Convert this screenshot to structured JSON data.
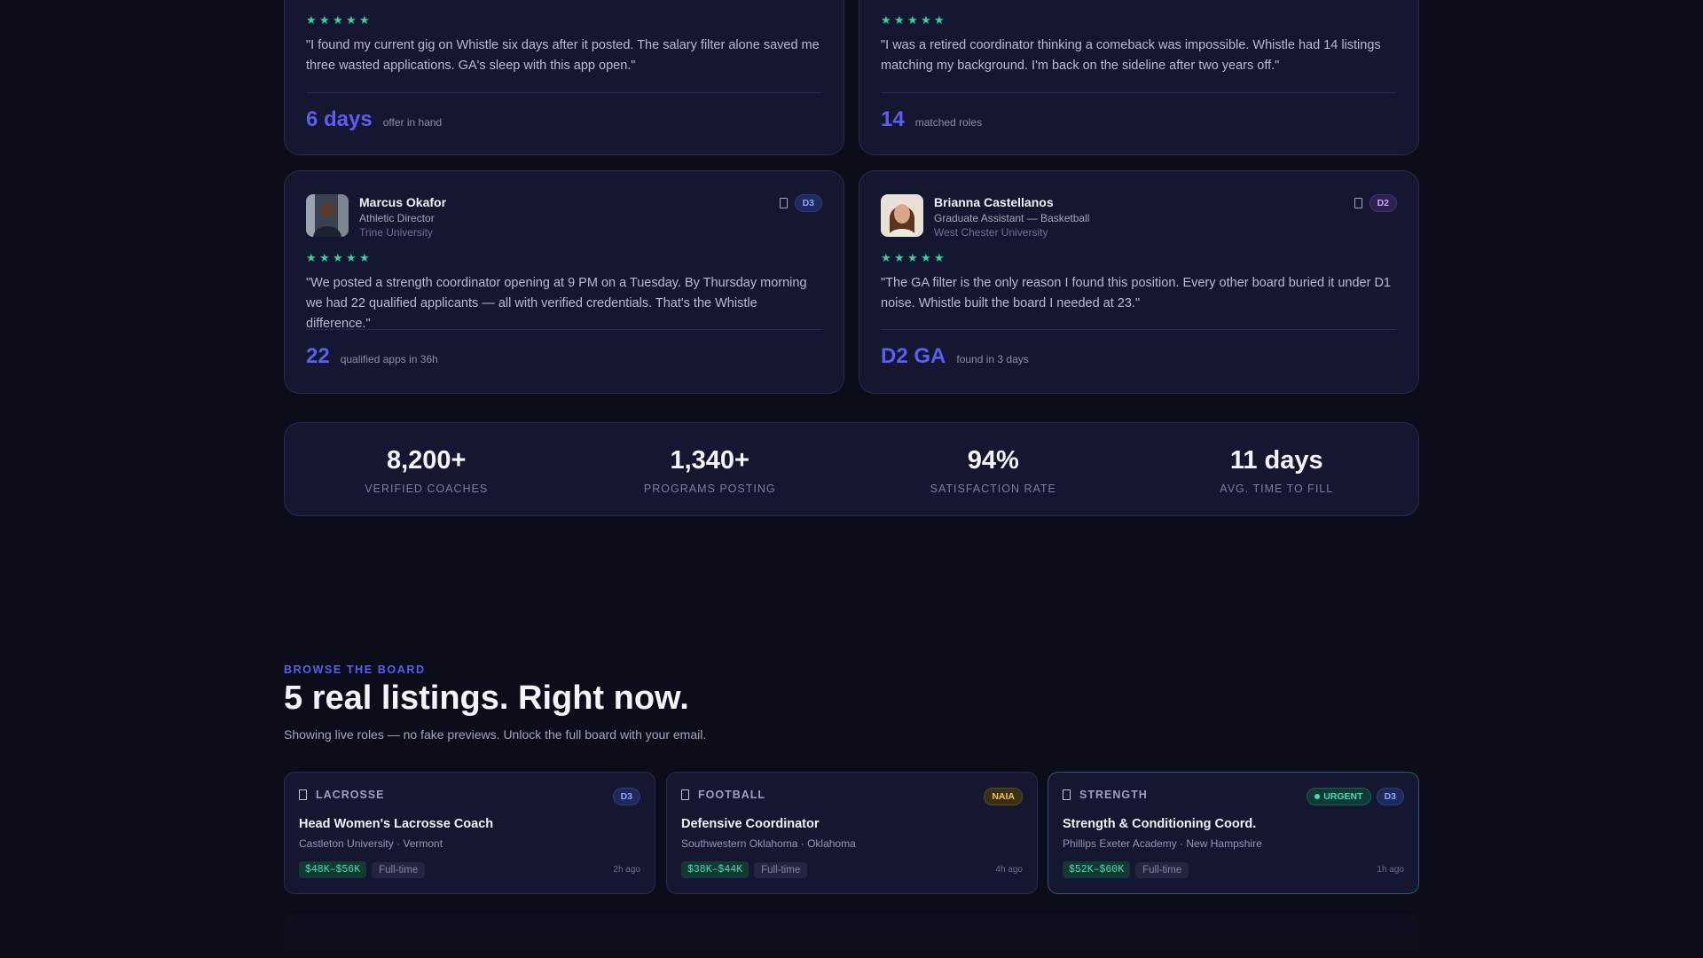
{
  "testimonials_top": [
    {
      "quote": "\"I found my current gig on Whistle six days after it posted. The salary filter alone saved me three wasted applications. GA's sleep with this app open.\"",
      "metric_value": "6 days",
      "metric_label": "offer in hand"
    },
    {
      "quote": "\"I was a retired coordinator thinking a comeback was impossible. Whistle had 14 listings matching my background. I'm back on the sideline after two years off.\"",
      "metric_value": "14",
      "metric_label": "matched roles"
    }
  ],
  "testimonials": [
    {
      "name": "Marcus Okafor",
      "role": "Athletic Director",
      "org": "Trine University",
      "division": "D3",
      "quote": "\"We posted a strength coordinator opening at 9 PM on a Tuesday. By Thursday morning we had 22 qualified applicants — all with verified credentials. That's the Whistle difference.\"",
      "metric_value": "22",
      "metric_label": "qualified apps in 36h"
    },
    {
      "name": "Brianna Castellanos",
      "role": "Graduate Assistant — Basketball",
      "org": "West Chester University",
      "division": "D2",
      "quote": "\"The GA filter is the only reason I found this position. Every other board buried it under D1 noise. Whistle built the board I needed at 23.\"",
      "metric_value": "D2 GA",
      "metric_label": "found in 3 days"
    }
  ],
  "stats": [
    {
      "value": "8,200+",
      "label": "VERIFIED COACHES"
    },
    {
      "value": "1,340+",
      "label": "PROGRAMS POSTING"
    },
    {
      "value": "94%",
      "label": "SATISFACTION RATE"
    },
    {
      "value": "11 days",
      "label": "AVG. TIME TO FILL"
    }
  ],
  "browse": {
    "eyebrow": "BROWSE THE BOARD",
    "heading": "5 real listings. Right now.",
    "subheading": "Showing live roles — no fake previews. Unlock the full board with your email."
  },
  "listings": [
    {
      "category": "LACROSSE",
      "division": "D3",
      "title": "Head Women's Lacrosse Coach",
      "location": "Castleton University · Vermont",
      "salary": "$48K–$56K",
      "type": "Full-time",
      "posted": "2h ago"
    },
    {
      "category": "FOOTBALL",
      "division": "NAIA",
      "title": "Defensive Coordinator",
      "location": "Southwestern Oklahoma · Oklahoma",
      "salary": "$38K–$44K",
      "type": "Full-time",
      "posted": "4h ago"
    },
    {
      "category": "STRENGTH",
      "urgent": "URGENT",
      "division": "D3",
      "title": "Strength & Conditioning Coord.",
      "location": "Phillips Exeter Academy · New Hampshire",
      "salary": "$52K–$60K",
      "type": "Full-time",
      "posted": "1h ago"
    }
  ],
  "colors": {
    "accent": "#5b5ef0",
    "star": "#2dd4a4",
    "background": "#0c0d1a",
    "card": "#15162f"
  },
  "icons": {
    "star": "star-icon",
    "bookmark": "bookmark-icon"
  }
}
